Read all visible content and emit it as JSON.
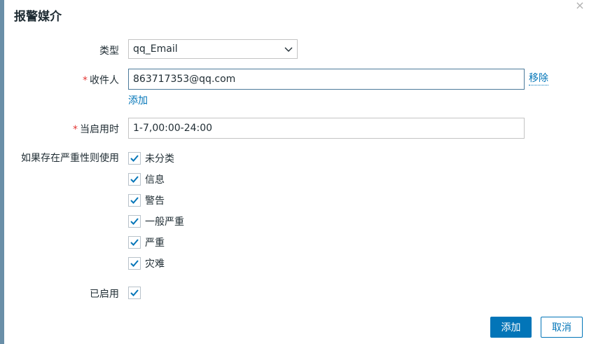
{
  "dialog": {
    "title": "报警媒介",
    "close_glyph": "×"
  },
  "form": {
    "type_label": "类型",
    "type_value": "qq_Email",
    "recipient_required": "*",
    "recipient_label": "收件人",
    "recipient_value": "863717353@qq.com",
    "remove_link": "移除",
    "add_link": "添加",
    "when_active_required": "*",
    "when_active_label": "当启用时",
    "when_active_value": "1-7,00:00-24:00",
    "severity_label": "如果存在严重性则使用",
    "severities": [
      {
        "label": "未分类",
        "checked": true
      },
      {
        "label": "信息",
        "checked": true
      },
      {
        "label": "警告",
        "checked": true
      },
      {
        "label": "一般严重",
        "checked": true
      },
      {
        "label": "严重",
        "checked": true
      },
      {
        "label": "灾难",
        "checked": true
      }
    ],
    "enabled_label": "已启用",
    "enabled_checked": true
  },
  "buttons": {
    "add": "添加",
    "cancel": "取消"
  },
  "colors": {
    "accent": "#0275b8",
    "required": "#e33734",
    "checkmark": "#0275b8"
  }
}
